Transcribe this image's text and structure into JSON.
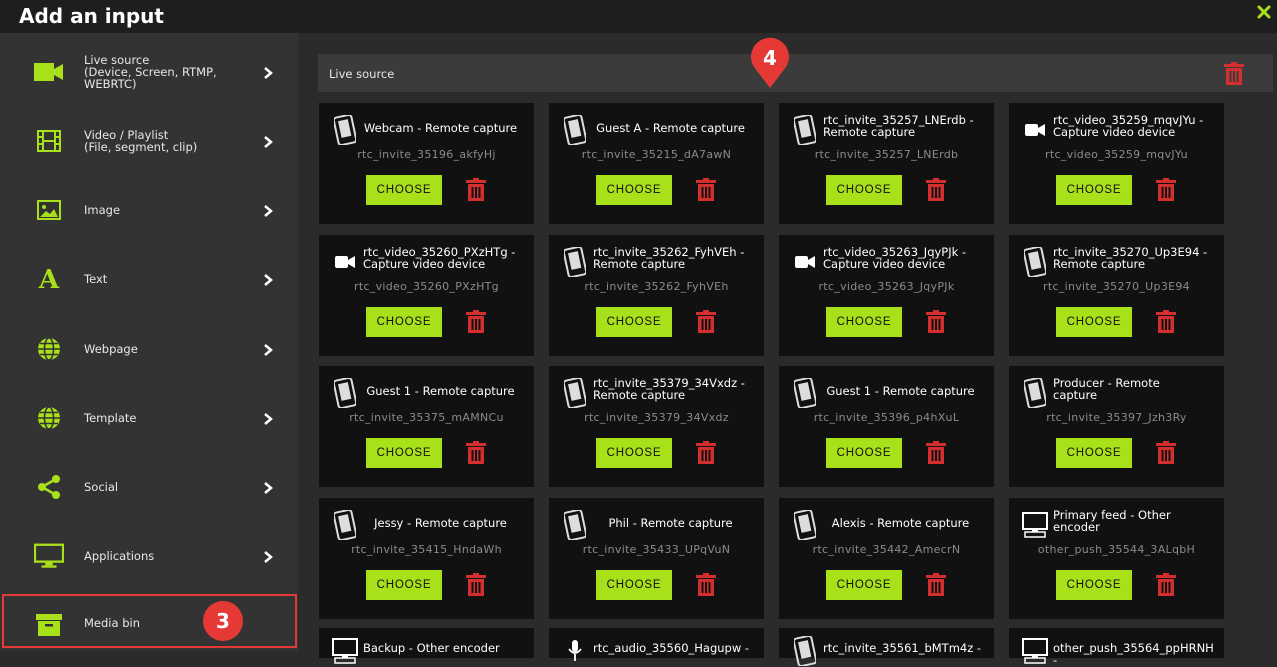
{
  "window": {
    "title": "Add an input"
  },
  "sidebar": {
    "items": [
      {
        "label": "Live source\n(Device, Screen, RTMP,\nWEBRTC)",
        "icon": "camera-icon"
      },
      {
        "label": "Video / Playlist\n(File, segment, clip)",
        "icon": "film-icon"
      },
      {
        "label": "Image",
        "icon": "image-icon"
      },
      {
        "label": "Text",
        "icon": "text-icon"
      },
      {
        "label": "Webpage",
        "icon": "globe-icon"
      },
      {
        "label": "Template",
        "icon": "globe-icon"
      },
      {
        "label": "Social",
        "icon": "share-icon"
      },
      {
        "label": "Applications",
        "icon": "monitor-icon"
      },
      {
        "label": "Media bin",
        "icon": "archive-icon"
      }
    ]
  },
  "badges": {
    "sidebar_step": "3",
    "cards_step": "4"
  },
  "section": {
    "label": "Live source"
  },
  "buttons": {
    "choose": "CHOOSE"
  },
  "cards": [
    {
      "title": "Webcam - Remote capture",
      "sub": "rtc_invite_35196_akfyHj",
      "icon": "phone-icon"
    },
    {
      "title": "Guest A - Remote capture",
      "sub": "rtc_invite_35215_dA7awN",
      "icon": "phone-icon"
    },
    {
      "title": "rtc_invite_35257_LNErdb -\nRemote capture",
      "sub": "rtc_invite_35257_LNErdb",
      "icon": "phone-icon"
    },
    {
      "title": "rtc_video_35259_mqvJYu -\nCapture video device",
      "sub": "rtc_video_35259_mqvJYu",
      "icon": "video-camera-icon"
    },
    {
      "title": "rtc_video_35260_PXzHTg -\nCapture video device",
      "sub": "rtc_video_35260_PXzHTg",
      "icon": "video-camera-icon"
    },
    {
      "title": "rtc_invite_35262_FyhVEh -\nRemote capture",
      "sub": "rtc_invite_35262_FyhVEh",
      "icon": "phone-icon"
    },
    {
      "title": "rtc_video_35263_JqyPJk -\nCapture video device",
      "sub": "rtc_video_35263_JqyPJk",
      "icon": "video-camera-icon"
    },
    {
      "title": "rtc_invite_35270_Up3E94 -\nRemote capture",
      "sub": "rtc_invite_35270_Up3E94",
      "icon": "phone-icon"
    },
    {
      "title": "Guest 1 - Remote capture",
      "sub": "rtc_invite_35375_mAMNCu",
      "icon": "phone-icon"
    },
    {
      "title": "rtc_invite_35379_34Vxdz -\nRemote capture",
      "sub": "rtc_invite_35379_34Vxdz",
      "icon": "phone-icon"
    },
    {
      "title": "Guest 1 - Remote capture",
      "sub": "rtc_invite_35396_p4hXuL",
      "icon": "phone-icon"
    },
    {
      "title": "Producer - Remote\ncapture",
      "sub": "rtc_invite_35397_Jzh3Ry",
      "icon": "phone-icon"
    },
    {
      "title": "Jessy - Remote capture",
      "sub": "rtc_invite_35415_HndaWh",
      "icon": "phone-icon"
    },
    {
      "title": "Phil - Remote capture",
      "sub": "rtc_invite_35433_UPqVuN",
      "icon": "phone-icon"
    },
    {
      "title": "Alexis - Remote capture",
      "sub": "rtc_invite_35442_AmecrN",
      "icon": "phone-icon"
    },
    {
      "title": "Primary feed - Other\nencoder",
      "sub": "other_push_35544_3ALqbH",
      "icon": "computer-icon"
    }
  ],
  "partial_cards": [
    {
      "title": "Backup - Other encoder",
      "icon": "computer-icon"
    },
    {
      "title": "rtc_audio_35560_Hagupw -",
      "icon": "microphone-icon"
    },
    {
      "title": "rtc_invite_35561_bMTm4z -",
      "icon": "phone-icon"
    },
    {
      "title": "other_push_35564_ppHRNH -",
      "icon": "computer-icon"
    }
  ]
}
